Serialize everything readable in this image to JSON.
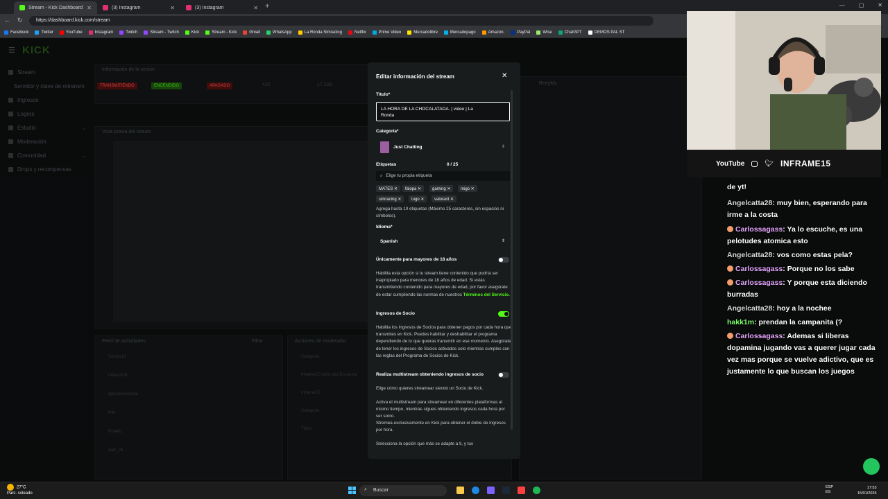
{
  "browser": {
    "tabs": [
      {
        "label": "Stream - Kick Dashboard",
        "active": true,
        "color": "#53fc18"
      },
      {
        "label": "(3) Instagram",
        "active": false,
        "color": "#e1306c"
      },
      {
        "label": "(3) Instagram",
        "active": false,
        "color": "#e1306c"
      }
    ],
    "url": "https://dashboard.kick.com/stream",
    "bookmarks": [
      "Facebook",
      "Twitter",
      "YouTube",
      "Instagram",
      "Twitch",
      "Stream - Twitch",
      "Kick",
      "Stream - Kick",
      "Gmail",
      "WhatsApp",
      "La Ronda Simracing",
      "Netflix",
      "Prime Video",
      "Mercadolibre",
      "Mercadopago",
      "Amazon.",
      "PayPal",
      "Wise",
      "ChatGPT",
      "DEMOS PAL ST"
    ]
  },
  "dashboard": {
    "logo": "KICK",
    "sidebar": [
      {
        "label": "Stream",
        "chev": false
      },
      {
        "label": "Servidor y clave de retransm",
        "chev": false
      },
      {
        "label": "Ingresos",
        "chev": false
      },
      {
        "label": "Logros",
        "chev": false
      },
      {
        "label": "Estudio",
        "chev": true
      },
      {
        "label": "Moderación",
        "chev": false
      },
      {
        "label": "Comunidad",
        "chev": true
      },
      {
        "label": "Drops y recompensas",
        "chev": false
      }
    ],
    "session_title": "Información de la sesión",
    "badges": [
      "TRANSMITIENDO",
      "ENCENDIDO",
      "APAGADO"
    ],
    "stats": [
      "432",
      "17.208"
    ],
    "preview_title": "Vista previa del stream",
    "feed_title": "Feed de actividades",
    "feed_filter": "Filtro",
    "feed_items": [
      "Santus13",
      "milos1624",
      "djtizianoescobar",
      "P4il",
      "Robeliz",
      "datz_25"
    ],
    "mod_title": "Acciones de moderador",
    "mod_items": [
      "Categoría",
      "inframe15 inició una Encuesta",
      "Inframe15",
      "Categoría",
      "Título"
    ],
    "chat_user": "ReeyMz"
  },
  "modal": {
    "title": "Editar información del stream",
    "title_label": "Título*",
    "title_value_line1": "LA HORA DE LA CHOCALATADA. | video | La",
    "title_value_line2": "Ronda",
    "category_label": "Categoría*",
    "category_value": "Just Chatting",
    "tags_label": "Etiquetas",
    "tags_count": "0 / 25",
    "tags_placeholder": "Elige tu propia etiqueta",
    "tags": [
      "MATES",
      "falopa",
      "gaming",
      "migo",
      "simracing",
      "tugo",
      "valorant"
    ],
    "tags_help": "Agrega hasta 10 etiquetas (Máximo 25 caracteres, sin espacios ni símbolos).",
    "language_label": "Idioma*",
    "language_value": "Spanish",
    "adult_label": "Únicamente para mayores de 18 años",
    "adult_on": false,
    "adult_help": "Habilita esta opción si tu stream tiene contenido que podría ser inapropiado para menores de 18 años de edad. Si estás transmitiendo contenido para mayores de edad, por favor asegúrate de estar cumpliendo las normas de nuestros",
    "adult_link": "Términos del Servicio.",
    "partner_label": "Ingresos de Socio",
    "partner_on": true,
    "partner_help": "Habilita los Ingresos de Socios para obtener pagos por cada hora que transmites en Kick. Puedes habilitar y deshabilitar el programa dependiendo de lo que quieras transmitir en ese momento. Asegúrate de tener los ingresos de Socios activados solo mientras cumples con las reglas del Programa de Socios de Kick.",
    "multistream_label": "Realiza multistream obteniendo ingresos de socio",
    "multistream_on": false,
    "multistream_help1": "Elige cómo quieres streamear siendo un Socio de Kick.",
    "multistream_help2": "Activa el multistream para streamear en diferentes plataformas al mismo tiempo, mientras sigues obteniendo ingresos cada hora por ser socio.",
    "multistream_help3": "Stremea exclusivamente en Kick para obtener el doble de ingresos por hora.",
    "multistream_help4": "Selecciona la opción que más se adapte a ti, y tus"
  },
  "overlay": {
    "socials": [
      "YouTube",
      "INFRAME15"
    ],
    "chat": [
      {
        "user": "",
        "text": "de yt!",
        "color": "w",
        "emote": false
      },
      {
        "user": "Angelcatta28",
        "text": ": muy bien, esperando para irme a la costa",
        "color": "w",
        "emote": false
      },
      {
        "user": "Carlossagass",
        "text": ": Ya lo escuche, es una pelotudes atomica esto",
        "color": "p",
        "emote": true
      },
      {
        "user": "Angelcatta28",
        "text": ": vos como estas pela?",
        "color": "w",
        "emote": false
      },
      {
        "user": "Carlossagass",
        "text": ": Porque no los sabe",
        "color": "p",
        "emote": true
      },
      {
        "user": "Carlossagass",
        "text": ": Y porque esta diciendo burradas",
        "color": "p",
        "emote": true
      },
      {
        "user": "Angelcatta28",
        "text": ": hoy a la nochee",
        "color": "w",
        "emote": false
      },
      {
        "user": "hakk1m",
        "text": ": prendan la campanita (?",
        "color": "g",
        "emote": false
      },
      {
        "user": "Carlossagass",
        "text": ": Ademas si liberas dopamina jugando vas a querer jugar cada vez mas porque se vuelve adictivo, que es justamente lo que buscan los juegos",
        "color": "p",
        "emote": true
      }
    ]
  },
  "taskbar": {
    "weather_temp": "27°C",
    "weather_text": "Parc. soleado",
    "search": "Buscar",
    "lang1": "ESP",
    "lang2": "ES",
    "time": "17:53",
    "date": "15/01/2026"
  }
}
